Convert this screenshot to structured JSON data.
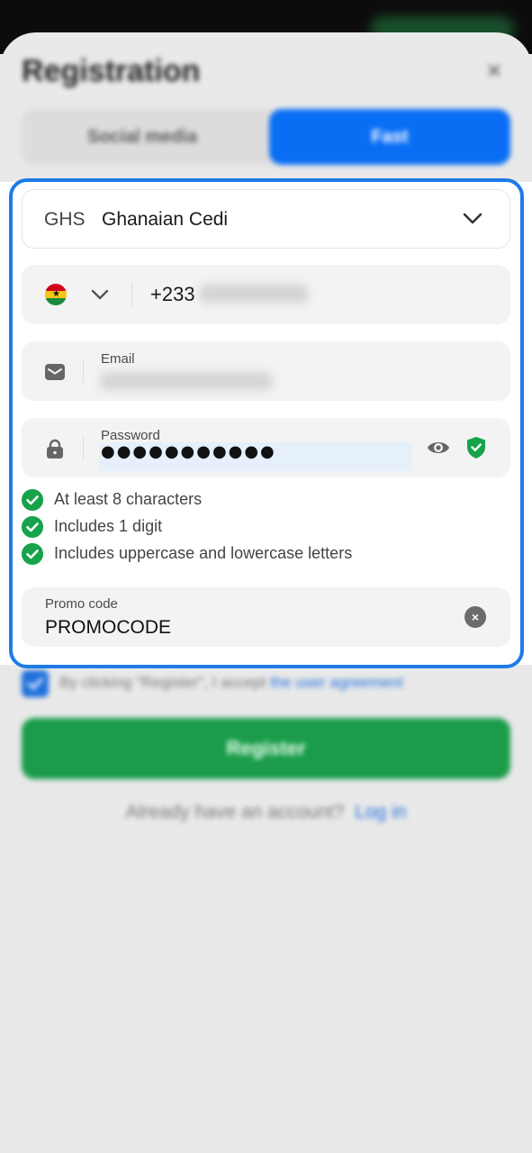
{
  "header": {
    "title": "Registration",
    "close_symbol": "×"
  },
  "tabs": [
    {
      "label": "Social media",
      "active": false
    },
    {
      "label": "Fast",
      "active": true
    }
  ],
  "currency": {
    "code": "GHS",
    "name": "Ghanaian Cedi",
    "icon": "chevron-down-icon"
  },
  "phone": {
    "country_flag": "ghana-flag-icon",
    "dial_code": "+233",
    "number_obscured": true
  },
  "email": {
    "label": "Email",
    "value_obscured": true,
    "icon": "envelope-icon"
  },
  "password": {
    "label": "Password",
    "masked_value": "●●●●●●●●●●●",
    "icon": "lock-icon",
    "show_icon": "eye-icon",
    "strength_icon": "shield-check-icon"
  },
  "password_rules": [
    {
      "text": "At least 8 characters",
      "met": true
    },
    {
      "text": "Includes 1 digit",
      "met": true
    },
    {
      "text": "Includes uppercase and lowercase letters",
      "met": true
    }
  ],
  "promo": {
    "label": "Promo code",
    "value": "PROMOCODE",
    "clear_symbol": "×"
  },
  "agreement": {
    "text": "By clicking \"Register\", I accept",
    "link": "the user agreement",
    "checked": true
  },
  "register_button": "Register",
  "login": {
    "prompt": "Already have an account?",
    "link": "Log in"
  },
  "colors": {
    "accent": "#0a6ef5",
    "success": "#16a34a",
    "register": "#1a9c4a",
    "highlight_border": "#1e7be8"
  }
}
